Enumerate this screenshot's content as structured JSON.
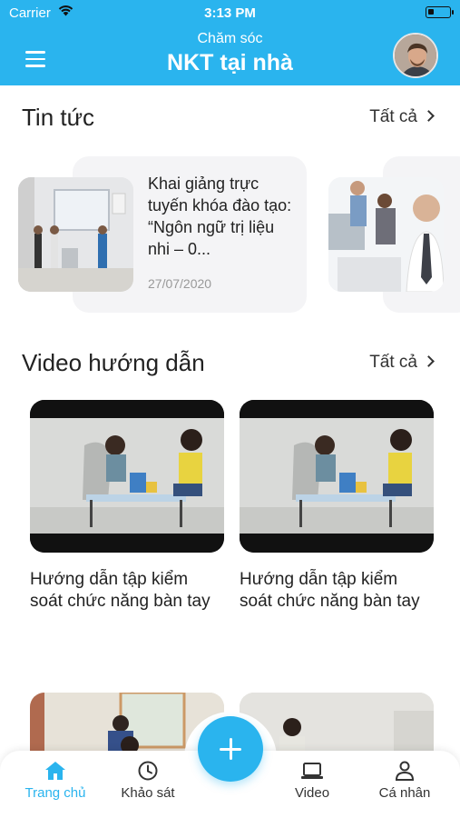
{
  "status_bar": {
    "carrier": "Carrier",
    "time": "3:13 PM"
  },
  "header": {
    "subtitle": "Chăm sóc",
    "title": "NKT tại nhà"
  },
  "news": {
    "title": "Tin tức",
    "see_all": "Tất cả",
    "items": [
      {
        "title": "Khai giảng trực tuyến khóa đào tạo: “Ngôn ngữ trị liệu nhi – 0...",
        "date": "27/07/2020"
      }
    ]
  },
  "videos": {
    "title": "Video hướng dẫn",
    "see_all": "Tất cả",
    "items": [
      {
        "title": "Hướng dẫn tập kiểm soát chức năng bàn tay"
      },
      {
        "title": "Hướng dẫn tập kiểm soát chức năng bàn tay"
      }
    ]
  },
  "bottom_nav": {
    "items": [
      {
        "label": "Trang chủ",
        "icon": "home-icon"
      },
      {
        "label": "Khảo sát",
        "icon": "clock-icon"
      },
      {
        "label": "Video",
        "icon": "laptop-icon"
      },
      {
        "label": "Cá nhân",
        "icon": "person-icon"
      }
    ],
    "active_index": 0
  },
  "colors": {
    "primary": "#2ab4ee",
    "text": "#222222",
    "muted": "#999999",
    "card_bg": "#f4f4f6"
  }
}
